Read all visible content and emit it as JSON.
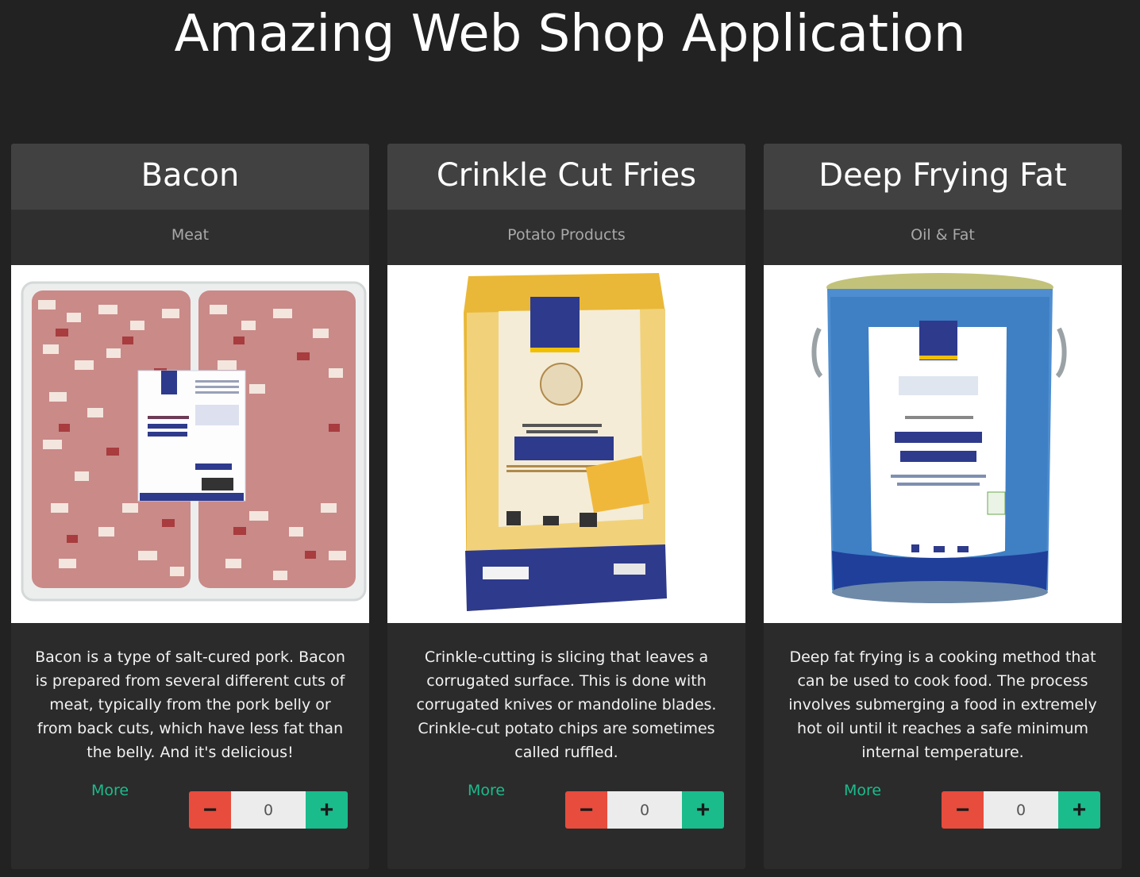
{
  "app": {
    "title": "Amazing Web Shop Application"
  },
  "colors": {
    "background": "#222222",
    "card_header": "#414141",
    "card_body": "#2b2b2b",
    "accent_green": "#1abc8c",
    "accent_red": "#e74c3c"
  },
  "products": [
    {
      "name": "Bacon",
      "category": "Meat",
      "image": "bacon-pack-image",
      "description": "Bacon is a type of salt-cured pork. Bacon is prepared from several different cuts of meat, typically from the pork belly or from back cuts, which have less fat than the belly. And it's delicious!",
      "more_label": "More",
      "minus_label": "−",
      "plus_label": "+",
      "quantity": "0"
    },
    {
      "name": "Crinkle Cut Fries",
      "category": "Potato Products",
      "image": "fries-bag-image",
      "description": "Crinkle-cutting is slicing that leaves a corrugated surface. This is done with corrugated knives or mandoline blades. Crinkle-cut potato chips are sometimes called ruffled.",
      "more_label": "More",
      "minus_label": "−",
      "plus_label": "+",
      "quantity": "0"
    },
    {
      "name": "Deep Frying Fat",
      "category": "Oil & Fat",
      "image": "frying-fat-bucket-image",
      "description": "Deep fat frying is a cooking method that can be used to cook food. The process involves submerging a food in extremely hot oil until it reaches a safe minimum internal temperature.",
      "more_label": "More",
      "minus_label": "−",
      "plus_label": "+",
      "quantity": "0"
    }
  ]
}
